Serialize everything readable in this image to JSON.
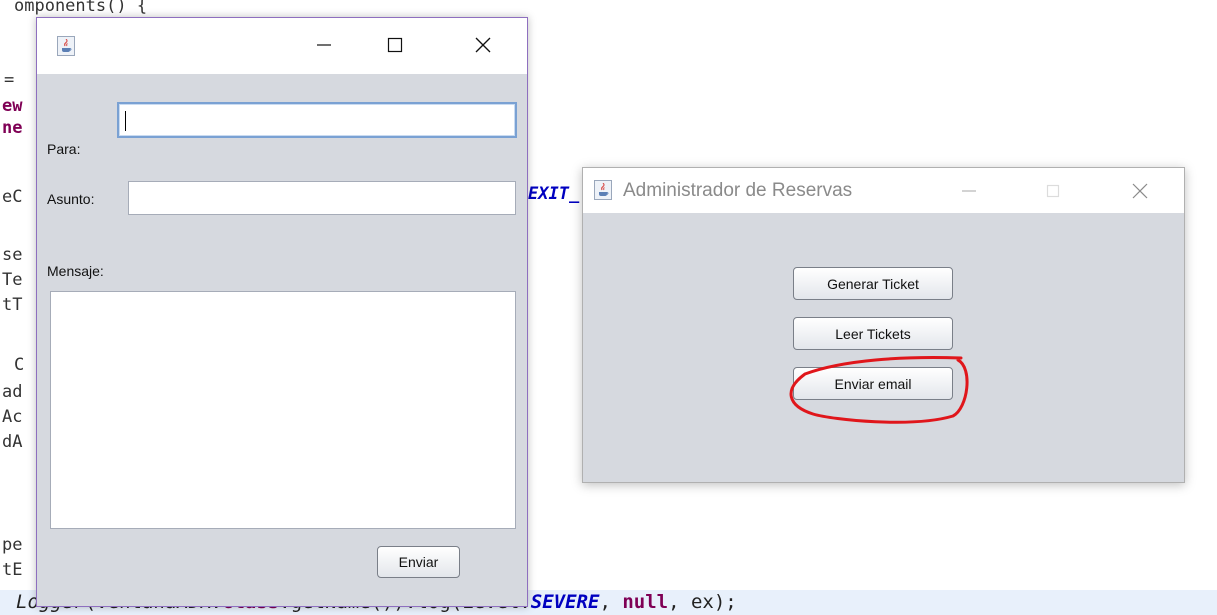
{
  "code_background": {
    "top_line": "omponents() {",
    "left_fragments": [
      "=",
      "ew",
      "ne",
      "eC",
      "se",
      "Te",
      "tT",
      "C",
      "ad",
      "Ac",
      "dA",
      "pe",
      "tE"
    ],
    "mid_fragment": "EXIT_",
    "bottom_line": {
      "part1": "Logger",
      "part2": "(VentanaADR.",
      "part3": "class",
      "part4": ".getName()).log(Level.",
      "part5": "SEVERE",
      "part6": ", ",
      "part7": "null",
      "part8": ", ex);"
    }
  },
  "email_window": {
    "para_label": "Para:",
    "para_value": "",
    "asunto_label": "Asunto:",
    "asunto_value": "",
    "mensaje_label": "Mensaje:",
    "mensaje_value": "",
    "send_button": "Enviar",
    "controls": [
      "minimize-icon",
      "maximize-icon",
      "close-icon"
    ]
  },
  "admin_window": {
    "title": "Administrador de Reservas",
    "buttons": {
      "generar": "Generar Ticket",
      "leer": "Leer Tickets",
      "enviar": "Enviar email"
    },
    "annotation_color": "#e0161b"
  }
}
